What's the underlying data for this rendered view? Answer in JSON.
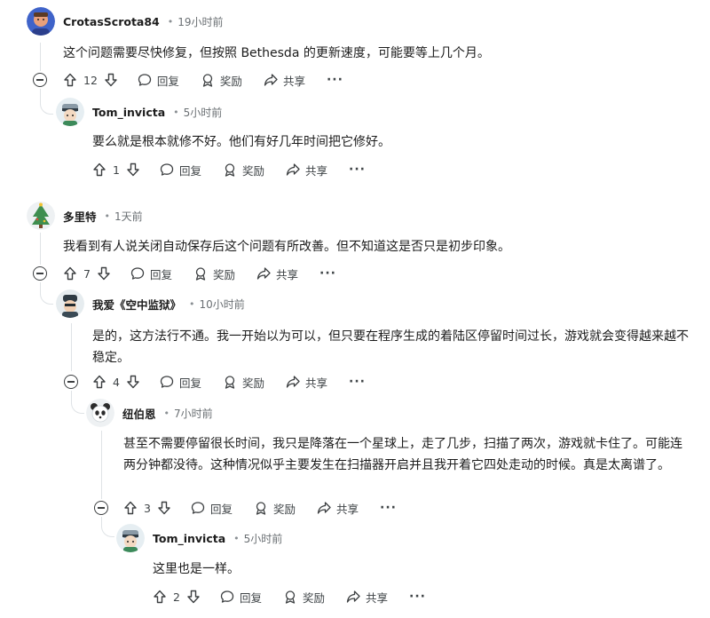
{
  "labels": {
    "reply": "回复",
    "award": "奖励",
    "share": "共享",
    "more": "···"
  },
  "comments": [
    {
      "author": "CrotasScrota84",
      "time": "19小时前",
      "body": "这个问题需要尽快修复，但按照 Bethesda 的更新速度，可能要等上几个月。",
      "votes": "12",
      "avatar": "avatar-blue-face"
    },
    {
      "author": "Tom_invicta",
      "time": "5小时前",
      "body": "要么就是根本就修不好。他们有好几年时间把它修好。",
      "votes": "1",
      "avatar": "avatar-cartoon-knight"
    },
    {
      "author": "多里特",
      "time": "1天前",
      "body": "我看到有人说关闭自动保存后这个问题有所改善。但不知道这是否只是初步印象。",
      "votes": "7",
      "avatar": "avatar-christmas-tree"
    },
    {
      "author": "我爱《空中监狱》",
      "time": "10小时前",
      "body": "是的，这方法行不通。我一开始以为可以，但只要在程序生成的着陆区停留时间过长，游戏就会变得越来越不稳定。",
      "votes": "4",
      "avatar": "avatar-cartoon-robot"
    },
    {
      "author": "纽伯恩",
      "time": "7小时前",
      "body": "甚至不需要停留很长时间，我只是降落在一个星球上，走了几步，扫描了两次，游戏就卡住了。可能连两分钟都没待。这种情况似乎主要发生在扫描器开启并且我开着它四处走动的时候。真是太离谱了。",
      "votes": "3",
      "avatar": "avatar-cartoon-panda"
    },
    {
      "author": "Tom_invicta",
      "time": "5小时前",
      "body": "这里也是一样。",
      "votes": "2",
      "avatar": "avatar-cartoon-knight"
    }
  ]
}
